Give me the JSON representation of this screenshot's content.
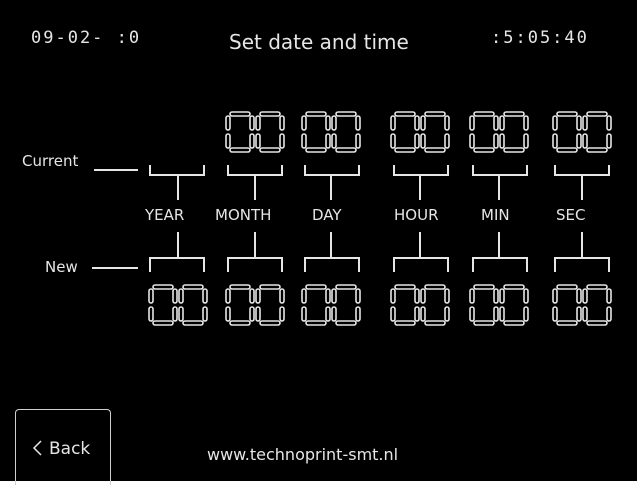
{
  "header": {
    "date": "09-02- :0",
    "title": "Set date and time",
    "time": ":5:05:40"
  },
  "labels": {
    "current": "Current",
    "new": "New"
  },
  "units": [
    "YEAR",
    "MONTH",
    "DAY",
    "HOUR",
    "MIN",
    "SEC"
  ],
  "current_values": [
    "00",
    "00",
    "00",
    "00",
    "00"
  ],
  "new_values": [
    "00",
    "00",
    "00",
    "00",
    "00",
    "00"
  ],
  "back_button": {
    "label": "Back",
    "icon": "chevron-left-icon"
  },
  "footer": {
    "url": "www.technoprint-smt.nl"
  },
  "colors": {
    "background": "#000000",
    "foreground": "#e6e6e6"
  }
}
